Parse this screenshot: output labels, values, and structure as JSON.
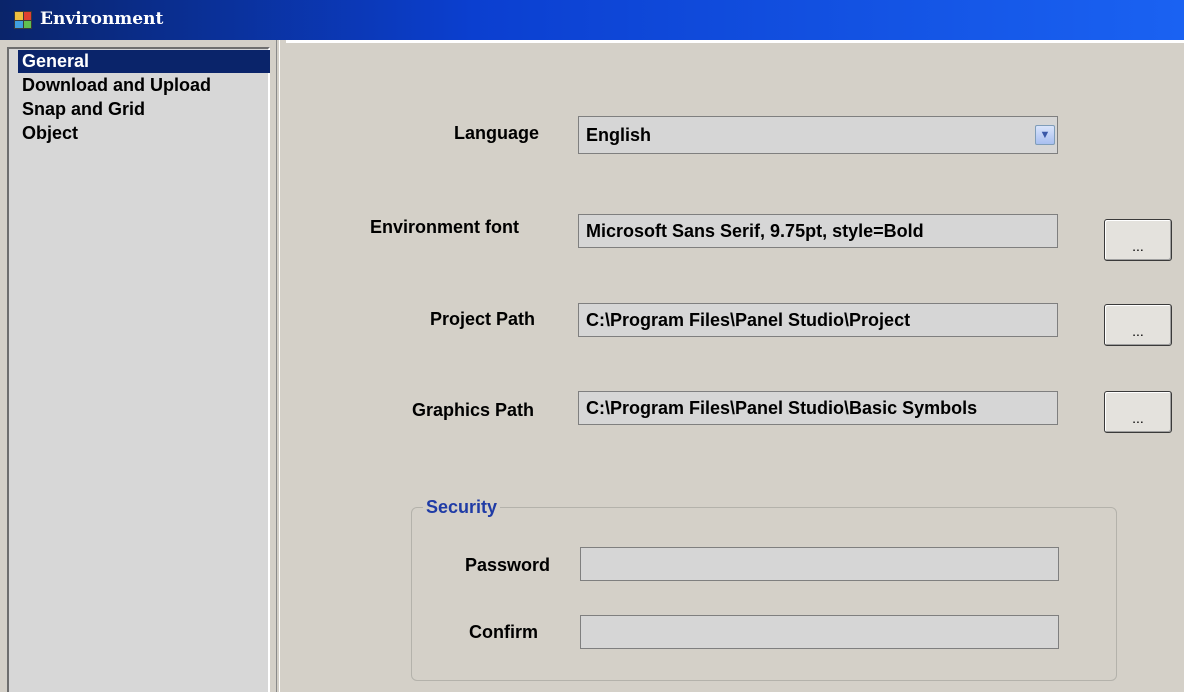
{
  "window": {
    "title": "Environment"
  },
  "sidebar": {
    "items": [
      {
        "label": "General",
        "selected": true
      },
      {
        "label": "Download and Upload"
      },
      {
        "label": "Snap and Grid"
      },
      {
        "label": "Object"
      }
    ]
  },
  "general": {
    "language": {
      "label": "Language",
      "value": "English"
    },
    "environment_font": {
      "label": "Environment font",
      "value": "Microsoft Sans Serif, 9.75pt, style=Bold",
      "button": "..."
    },
    "project_path": {
      "label": "Project Path",
      "value": "C:\\Program Files\\Panel Studio\\Project",
      "button": "..."
    },
    "graphics_path": {
      "label": "Graphics Path",
      "value": "C:\\Program Files\\Panel Studio\\Basic Symbols",
      "button": "..."
    },
    "security": {
      "title": "Security",
      "password_label": "Password",
      "password_value": "",
      "confirm_label": "Confirm",
      "confirm_value": ""
    }
  },
  "colors": {
    "titlebar": "#0b3fd0",
    "selection": "#0a246a",
    "group_title": "#1f3ba6",
    "background": "#d4d0c8"
  }
}
